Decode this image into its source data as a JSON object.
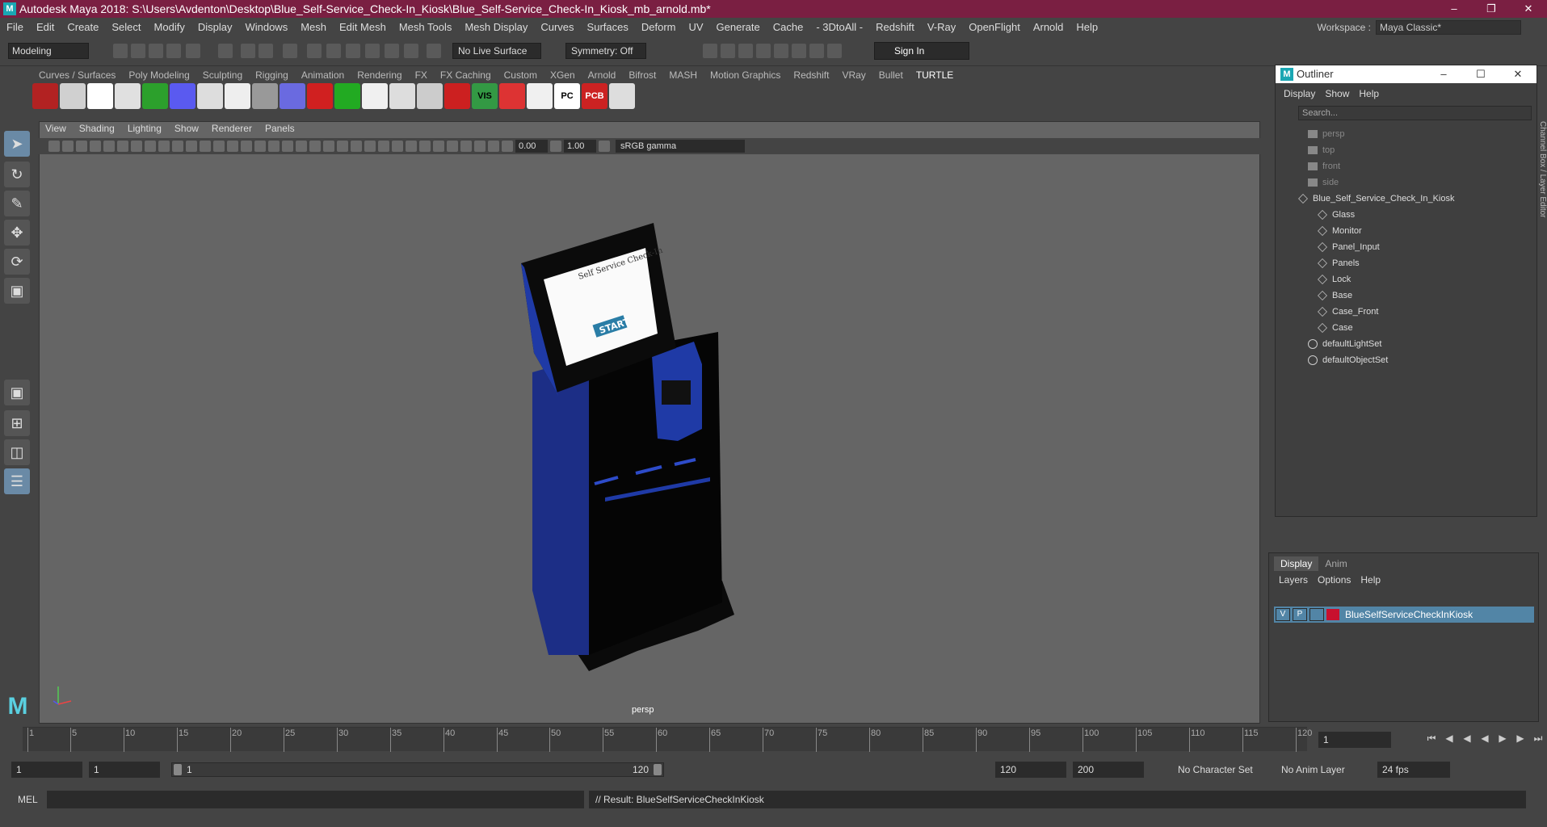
{
  "window": {
    "title": "Autodesk Maya 2018: S:\\Users\\Avdenton\\Desktop\\Blue_Self-Service_Check-In_Kiosk\\Blue_Self-Service_Check-In_Kiosk_mb_arnold.mb*",
    "app_logo": "M"
  },
  "menubar": {
    "items": [
      "File",
      "Edit",
      "Create",
      "Select",
      "Modify",
      "Display",
      "Windows",
      "Mesh",
      "Edit Mesh",
      "Mesh Tools",
      "Mesh Display",
      "Curves",
      "Surfaces",
      "Deform",
      "UV",
      "Generate",
      "Cache",
      "- 3DtoAll -",
      "Redshift",
      "V-Ray",
      "OpenFlight",
      "Arnold",
      "Help"
    ]
  },
  "workspace": {
    "label": "Workspace :",
    "value": "Maya Classic*"
  },
  "status": {
    "mode": "Modeling",
    "live_surface": "No Live Surface",
    "symmetry": "Symmetry: Off",
    "sign_in": "Sign In"
  },
  "shelf": {
    "tabs": [
      "Curves / Surfaces",
      "Poly Modeling",
      "Sculpting",
      "Rigging",
      "Animation",
      "Rendering",
      "FX",
      "FX Caching",
      "Custom",
      "XGen",
      "Arnold",
      "Bifrost",
      "MASH",
      "Motion Graphics",
      "Redshift",
      "VRay",
      "Bullet",
      "TURTLE"
    ],
    "active_tab": "TURTLE",
    "icon_colors": [
      "#b22222",
      "#d0d0d0",
      "#ffffff",
      "#e0e0e0",
      "#2ca02c",
      "#5a5af0",
      "#dddddd",
      "#eeeeee",
      "#999999",
      "#6a6ae0",
      "#d02020",
      "#22aa22",
      "#f0f0f0",
      "#dddddd",
      "#cccccc",
      "#cc2020",
      "#339944",
      "#dd3333",
      "#f0f0f0",
      "#ffffff",
      "#cc2222",
      "#dddddd"
    ],
    "icon_texts": {
      "vis": "VIS",
      "pc": "PC",
      "pcb": "PCB"
    }
  },
  "viewport": {
    "menus": [
      "View",
      "Shading",
      "Lighting",
      "Show",
      "Renderer",
      "Panels"
    ],
    "exposure": "0.00",
    "gamma": "1.00",
    "color_space": "sRGB gamma",
    "camera": "persp",
    "kiosk": {
      "screen_title": "Self Service Check-In",
      "start_label": "START"
    }
  },
  "outliner": {
    "title": "Outliner",
    "menus": [
      "Display",
      "Show",
      "Help"
    ],
    "search_placeholder": "Search...",
    "items": [
      {
        "label": "persp",
        "type": "camera",
        "dim": true,
        "indent": 1
      },
      {
        "label": "top",
        "type": "camera",
        "dim": true,
        "indent": 1
      },
      {
        "label": "front",
        "type": "camera",
        "dim": true,
        "indent": 1
      },
      {
        "label": "side",
        "type": "camera",
        "dim": true,
        "indent": 1
      },
      {
        "label": "Blue_Self_Service_Check_In_Kiosk",
        "type": "group",
        "dim": false,
        "indent": 0
      },
      {
        "label": "Glass",
        "type": "mesh",
        "dim": false,
        "indent": 2
      },
      {
        "label": "Monitor",
        "type": "mesh",
        "dim": false,
        "indent": 2
      },
      {
        "label": "Panel_Input",
        "type": "mesh",
        "dim": false,
        "indent": 2
      },
      {
        "label": "Panels",
        "type": "mesh",
        "dim": false,
        "indent": 2
      },
      {
        "label": "Lock",
        "type": "mesh",
        "dim": false,
        "indent": 2
      },
      {
        "label": "Base",
        "type": "mesh",
        "dim": false,
        "indent": 2
      },
      {
        "label": "Case_Front",
        "type": "mesh",
        "dim": false,
        "indent": 2
      },
      {
        "label": "Case",
        "type": "mesh",
        "dim": false,
        "indent": 2
      },
      {
        "label": "defaultLightSet",
        "type": "set",
        "dim": false,
        "indent": 1
      },
      {
        "label": "defaultObjectSet",
        "type": "set",
        "dim": false,
        "indent": 1
      }
    ]
  },
  "channel_box_label": "Channel Box / Layer Editor",
  "layers": {
    "tabs": [
      "Display",
      "Anim"
    ],
    "active_tab": "Display",
    "menus": [
      "Layers",
      "Options",
      "Help"
    ],
    "row": {
      "v": "V",
      "p": "P",
      "name": "BlueSelfServiceCheckInKiosk",
      "color": "#c8102e"
    }
  },
  "timeline": {
    "ticks": [
      1,
      5,
      10,
      15,
      20,
      25,
      30,
      35,
      40,
      45,
      50,
      55,
      60,
      65,
      70,
      75,
      80,
      85,
      90,
      95,
      100,
      105,
      110,
      115,
      120
    ],
    "current_frame": "1"
  },
  "range": {
    "start": "1",
    "anim_start": "1",
    "slider_start": "1",
    "slider_end": "120",
    "end": "120",
    "anim_end": "200",
    "character_set": "No Character Set",
    "anim_layer": "No Anim Layer",
    "fps": "24 fps"
  },
  "command": {
    "mode": "MEL",
    "result": "// Result: BlueSelfServiceCheckInKiosk"
  }
}
